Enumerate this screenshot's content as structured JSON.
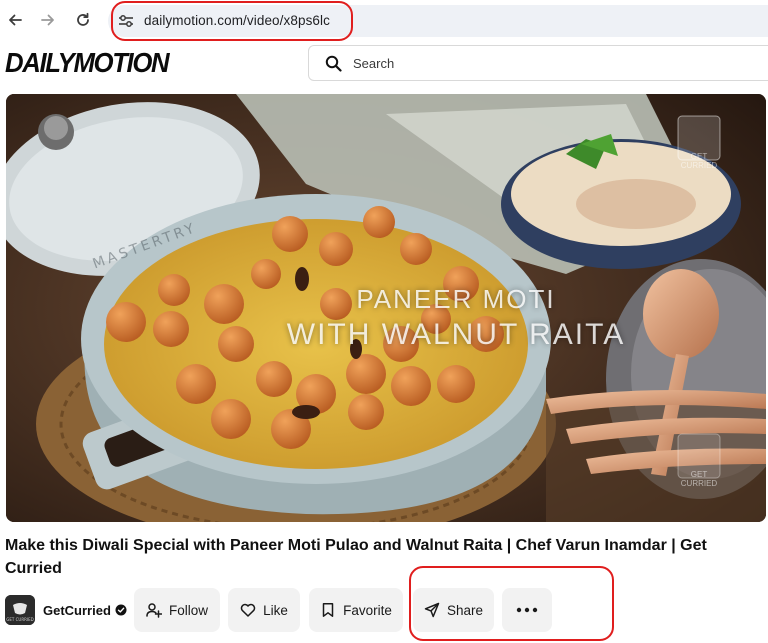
{
  "browser": {
    "url": "dailymotion.com/video/x8ps6lc"
  },
  "site": {
    "logo": "DAILYMOTION",
    "search_placeholder": "Search"
  },
  "video": {
    "overlay_line1": "PANEER MOTI",
    "overlay_line2": "WITH WALNUT RAITA",
    "cookware_brand": "MASTERTRY",
    "watermark": "GET CURRIED",
    "title": "Make this Diwali Special with Paneer Moti Pulao and Walnut Raita | Chef Varun Inamdar | Get Curried"
  },
  "channel": {
    "name": "GetCurried",
    "avatar_text": "GET CURRIED",
    "verified_icon": "verified-badge-icon"
  },
  "actions": {
    "follow": "Follow",
    "like": "Like",
    "favorite": "Favorite",
    "share": "Share",
    "more": "..."
  },
  "annotations": {
    "highlight_color": "#e01e1e"
  }
}
